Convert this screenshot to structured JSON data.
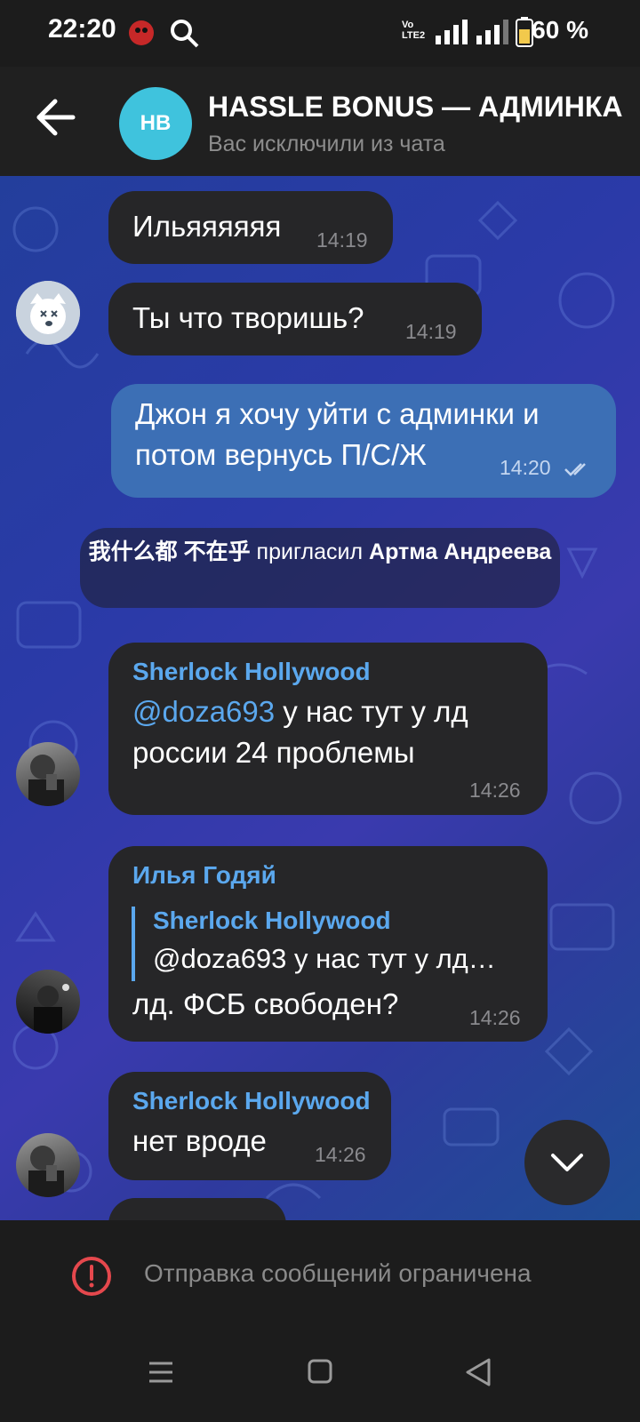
{
  "status": {
    "time": "22:20",
    "network_label": "Vo LTE2",
    "battery": "60 %"
  },
  "header": {
    "avatar_initials": "НВ",
    "title": "HASSLE BONUS — АДМИНКА",
    "subtitle": "Вас исключили из чата"
  },
  "messages": [
    {
      "text": "Ильяяяяяя",
      "time": "14:19"
    },
    {
      "text": "Ты что творишь?",
      "time": "14:19"
    },
    {
      "line1": "Джон я хочу уйти с админки и",
      "line2": "потом вернусь П/С/Ж",
      "time": "14:20"
    },
    {
      "sender": "Sherlock Hollywood",
      "mention": "@doza693",
      "line1_rest": "  у нас тут у лд",
      "line2": "россии 24 проблемы",
      "time": "14:26"
    },
    {
      "sender": "Илья Годяй",
      "quote_sender": "Sherlock Hollywood",
      "quote_text": "@doza693  у нас тут у лд…",
      "text": "лд. ФСБ свободен?",
      "time": "14:26"
    },
    {
      "sender": "Sherlock Hollywood",
      "text": "нет вроде",
      "time": "14:26"
    }
  ],
  "service": {
    "actor": "我什么都 不在乎",
    "action": " пригласил ",
    "target": "Артма Андреева"
  },
  "footer": {
    "restriction_text": "Отправка сообщений ограничена"
  },
  "colors": {
    "accent": "#5ba8ee",
    "outgoing_bubble": "#3c6fb5",
    "incoming_bubble": "#262628",
    "warning": "#e5484d"
  }
}
